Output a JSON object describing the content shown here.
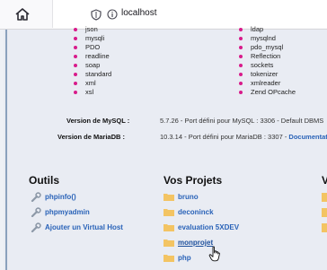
{
  "browser": {
    "url": "localhost"
  },
  "extensions_left": [
    "json",
    "mysqli",
    "PDO",
    "readline",
    "soap",
    "standard",
    "xml",
    "xsl"
  ],
  "extensions_right": [
    "ldap",
    "mysqlnd",
    "pdo_mysql",
    "Reflection",
    "sockets",
    "tokenizer",
    "xmlreader",
    "Zend OPcache"
  ],
  "versions": {
    "mysql_label": "Version de MySQL :",
    "mysql_value": "5.7.26 - Port défini pour MySQL : 3306 - Default DBMS",
    "mariadb_label": "Version de MariaDB :",
    "mariadb_value": "10.3.14 - Port défini pour MariaDB : 3307 - ",
    "mariadb_link": "Documentation"
  },
  "tools": {
    "title": "Outils",
    "items": [
      "phpinfo()",
      "phpmyadmin",
      "Ajouter un Virtual Host"
    ]
  },
  "projects": {
    "title": "Vos Projets",
    "items": [
      "bruno",
      "deconinck",
      "evaluation 5XDEV",
      "monprojet",
      "php"
    ],
    "hovered": "monprojet"
  },
  "third_column": {
    "title": "V"
  },
  "colors": {
    "link": "#2a63b8",
    "bullet": "#d81b8b",
    "folder": "#f3c463",
    "page_bg": "#e9ecf3"
  },
  "icons": {
    "home": "home-icon",
    "shield": "shield-icon",
    "info": "info-icon",
    "tool": "wrench-icon",
    "folder": "folder-icon",
    "cursor": "hand-pointer-icon"
  }
}
